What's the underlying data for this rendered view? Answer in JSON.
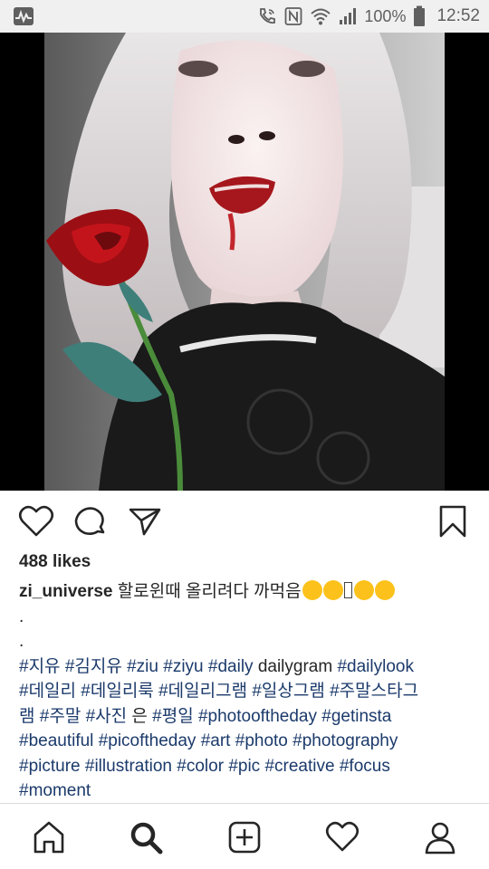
{
  "status_bar": {
    "battery": "100%",
    "time": "12:52",
    "icons": [
      "activity-icon",
      "wifi-call-icon",
      "nfc-icon",
      "wifi-icon",
      "signal-icon",
      "battery-icon"
    ]
  },
  "post": {
    "image_description_icon": "photo",
    "likes": "488 likes",
    "username": "zi_universe",
    "caption_text": "할로윈때 올리려다 까먹음",
    "dot1": ".",
    "dot2": ".",
    "tags_line1": [
      "#지유",
      "#김지유",
      "#ziu",
      "#ziyu",
      "#daily"
    ],
    "plain1": "dailygram",
    "tags_line1b": [
      "#dailylook"
    ],
    "tags_line2": [
      "#데일리",
      "#데일리룩",
      "#데일리그램",
      "#일상그램",
      "#주말스타그"
    ],
    "tags_line3a": [
      "램",
      "#주말",
      "#사진"
    ],
    "plain2": "은",
    "tags_line3b": [
      "#평일",
      "#photooftheday",
      "#getinsta"
    ],
    "tags_line4": [
      "#beautiful",
      "#picoftheday",
      "#art",
      "#photo",
      "#photography"
    ],
    "tags_line5": [
      "#picture",
      "#illustration",
      "#color",
      "#pic",
      "#creative",
      "#focus"
    ],
    "tags_line6": [
      "#moment"
    ]
  },
  "actions": {
    "like": "heart-icon",
    "comment": "comment-icon",
    "share": "share-icon",
    "save": "bookmark-icon"
  },
  "bottom_nav": [
    "home-icon",
    "search-icon",
    "add-post-icon",
    "activity-heart-icon",
    "profile-icon"
  ],
  "colors": {
    "hashtag": "#1b3a6b",
    "text": "#262626",
    "status_bar": "#f0f0f0"
  }
}
